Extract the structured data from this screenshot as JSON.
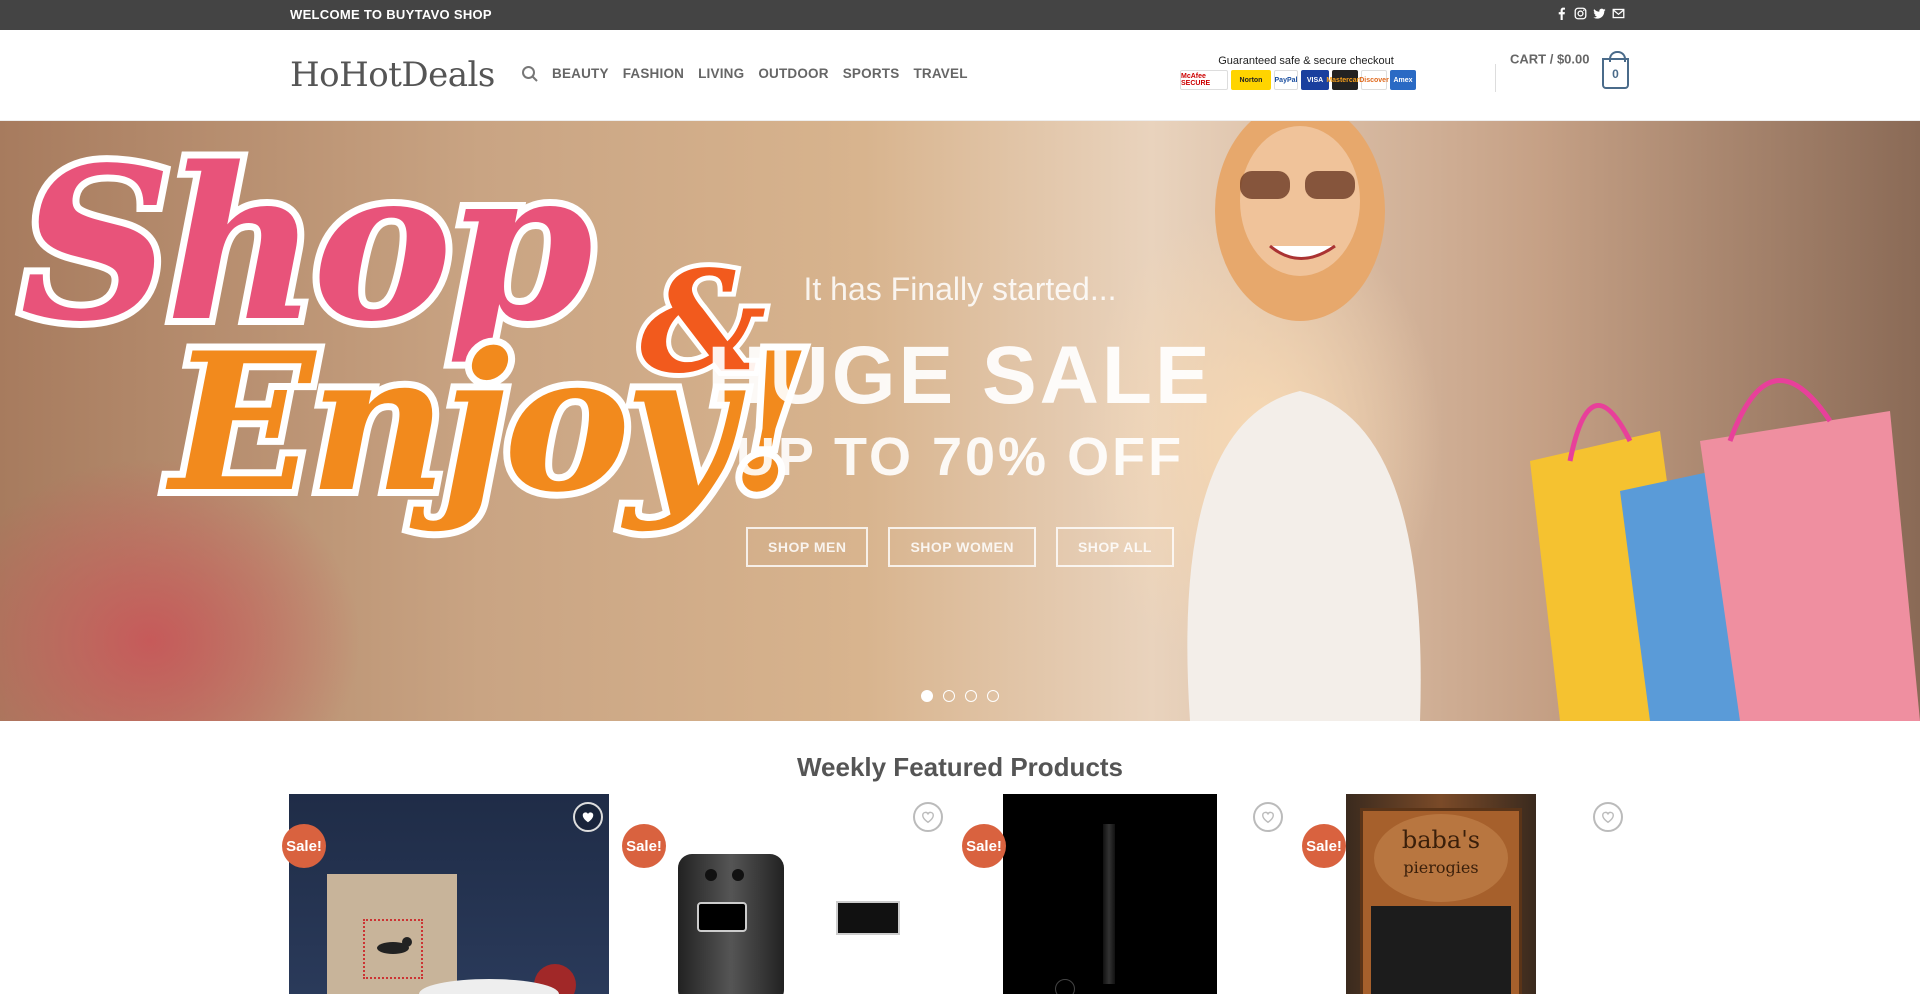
{
  "topbar": {
    "welcome": "WELCOME TO BUYTAVO SHOP",
    "social_icons": [
      "facebook-icon",
      "instagram-icon",
      "twitter-icon",
      "envelope-icon"
    ]
  },
  "header": {
    "logo": "HoHotDeals",
    "nav": [
      "BEAUTY",
      "FASHION",
      "LIVING",
      "OUTDOOR",
      "SPORTS",
      "TRAVEL"
    ],
    "secure_caption": "Guaranteed safe & secure checkout",
    "secure_badges": [
      "McAfee SECURE",
      "Norton",
      "PayPal",
      "VISA",
      "Mastercard",
      "Discover",
      "Amex"
    ],
    "cart_label": "CART / $0.00",
    "cart_count": "0"
  },
  "hero": {
    "art_text_1": "Shop",
    "art_text_amp": "&",
    "art_text_2": "Enjoy!",
    "tagline": "It has Finally started...",
    "headline": "HUGE SALE",
    "subheadline": "UP TO 70% OFF",
    "buttons": [
      "SHOP MEN",
      "SHOP WOMEN",
      "SHOP ALL"
    ],
    "slide_count": 4,
    "active_slide": 1
  },
  "featured": {
    "title": "Weekly Featured Products",
    "products": [
      {
        "badge": "Sale!"
      },
      {
        "badge": "Sale!"
      },
      {
        "badge": "Sale!"
      },
      {
        "badge": "Sale!",
        "image_text_1": "baba's",
        "image_text_2": "pierogies"
      }
    ]
  },
  "colors": {
    "topbar_bg": "#444444",
    "sale_badge": "#d9623f",
    "cart_accent": "#4a6b8a"
  }
}
